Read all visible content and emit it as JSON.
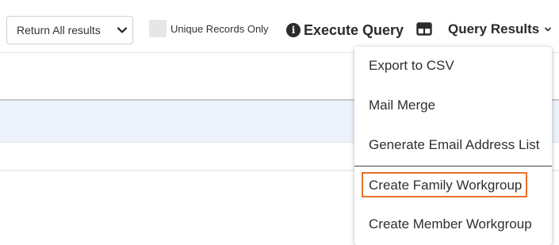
{
  "toolbar": {
    "result_mode": "Return All results",
    "unique_label": "Unique Records Only",
    "unique_checked": false,
    "execute_label": "Execute Query",
    "query_results_label": "Query Results"
  },
  "menu": {
    "items": [
      "Export to CSV",
      "Mail Merge",
      "Generate Email Address List",
      "Create Family Workgroup",
      "Create Member Workgroup"
    ],
    "highlighted_item": "Create Family Workgroup"
  },
  "colors": {
    "highlight_border": "#e8712a",
    "row_band": "#eef2fb"
  }
}
